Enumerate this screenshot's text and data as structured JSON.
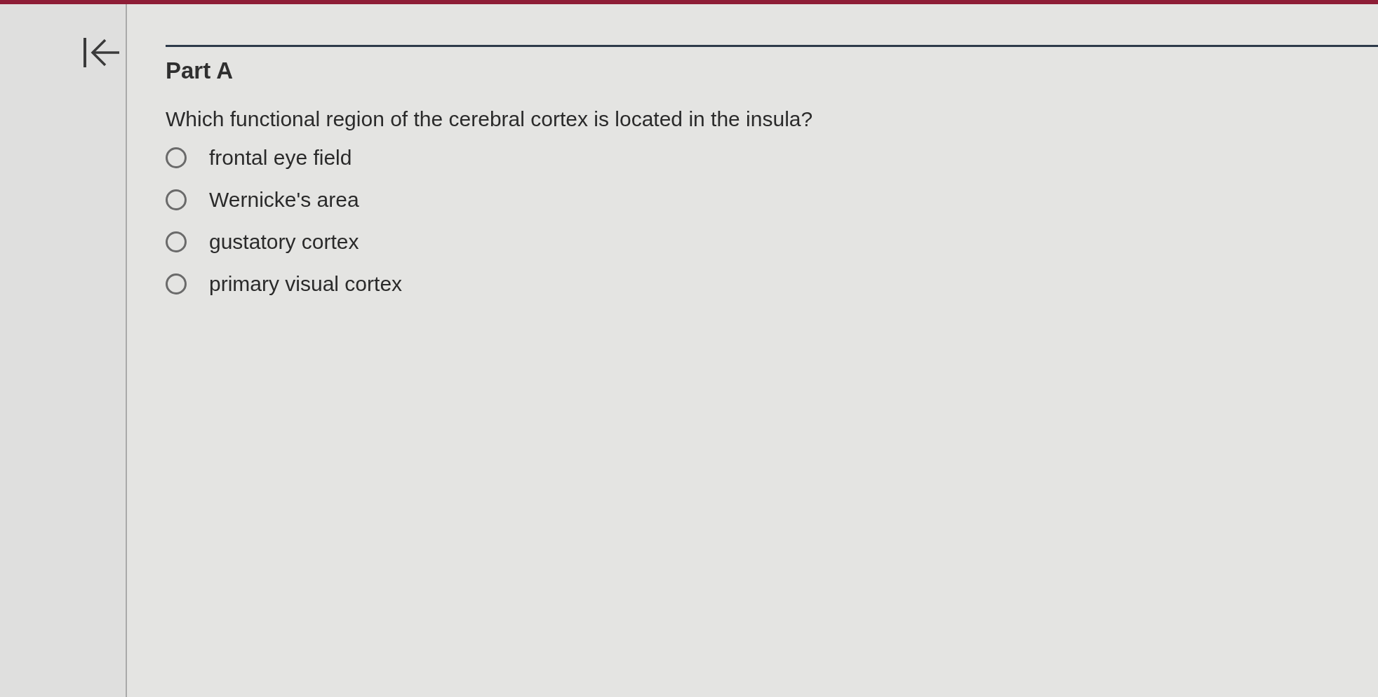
{
  "part": {
    "title": "Part A"
  },
  "question": {
    "text": "Which functional region of the cerebral cortex is located in the insula?"
  },
  "options": [
    {
      "label": "frontal eye field",
      "selected": false
    },
    {
      "label": "Wernicke's area",
      "selected": false
    },
    {
      "label": "gustatory cortex",
      "selected": false
    },
    {
      "label": "primary visual cortex",
      "selected": false
    }
  ]
}
